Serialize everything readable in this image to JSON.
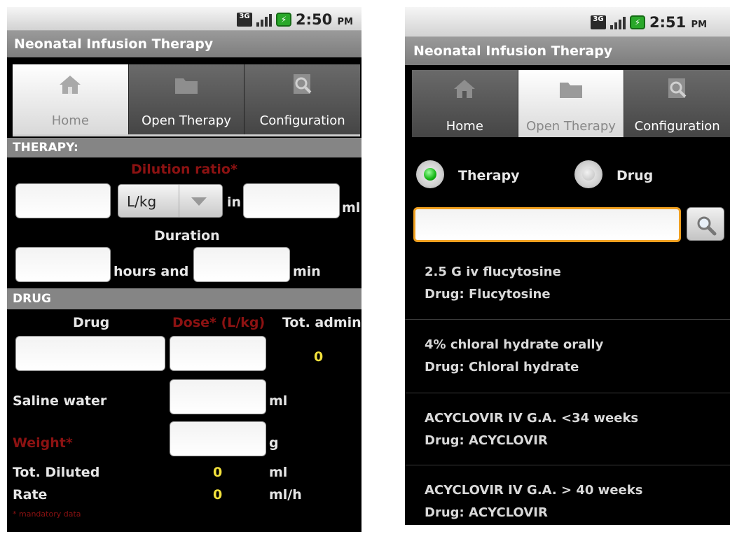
{
  "left": {
    "status": {
      "time": "2:50",
      "ampm": "PM",
      "network": "3G",
      "battery_icon": "battery-charging-icon"
    },
    "title": "Neonatal Infusion Therapy",
    "tabs": [
      {
        "label": "Home",
        "icon": "home-icon",
        "selected": true
      },
      {
        "label": "Open Therapy",
        "icon": "folder-icon",
        "selected": false
      },
      {
        "label": "Configuration",
        "icon": "config-search-icon",
        "selected": false
      }
    ],
    "therapy_section": "THERAPY:",
    "dilution_label": "Dilution ratio*",
    "unit_select": "L/kg",
    "in_label": "in",
    "ml_label": "ml",
    "duration_label": "Duration",
    "hours_and_label": "hours and",
    "min_label": "min",
    "drug_section": "DRUG",
    "col_drug": "Drug",
    "col_dose": "Dose* (L/kg)",
    "col_tot_admin": "Tot. admin",
    "tot_admin_value": "0",
    "saline_label": "Saline water",
    "saline_unit": "ml",
    "weight_label": "Weight*",
    "weight_unit": "g",
    "tot_diluted_label": "Tot. Diluted",
    "tot_diluted_value": "0",
    "tot_diluted_unit": "ml",
    "rate_label": "Rate",
    "rate_value": "0",
    "rate_unit": "ml/h",
    "mandatory_note": "* mandatory data",
    "colors": {
      "required": "#8c1212",
      "value": "#f2e13c"
    }
  },
  "right": {
    "status": {
      "time": "2:51",
      "ampm": "PM",
      "network": "3G",
      "battery_icon": "battery-charging-icon"
    },
    "title": "Neonatal Infusion Therapy",
    "tabs": [
      {
        "label": "Home",
        "icon": "home-icon",
        "selected": false
      },
      {
        "label": "Open Therapy",
        "icon": "folder-icon",
        "selected": true
      },
      {
        "label": "Configuration",
        "icon": "config-search-icon",
        "selected": false
      }
    ],
    "radio_therapy": "Therapy",
    "radio_drug": "Drug",
    "selected_radio": "Therapy",
    "search_value": "",
    "items": [
      {
        "line1": "2.5 G iv flucytosine",
        "line2": "Drug: Flucytosine"
      },
      {
        "line1": "4% chloral hydrate orally",
        "line2": "Drug: Chloral hydrate"
      },
      {
        "line1": "ACYCLOVIR IV G.A. <34 weeks",
        "line2": "Drug: ACYCLOVIR"
      },
      {
        "line1": "ACYCLOVIR IV G.A. > 40 weeks",
        "line2": "Drug: ACYCLOVIR"
      }
    ],
    "colors": {
      "search_focus": "#f0a020"
    }
  }
}
